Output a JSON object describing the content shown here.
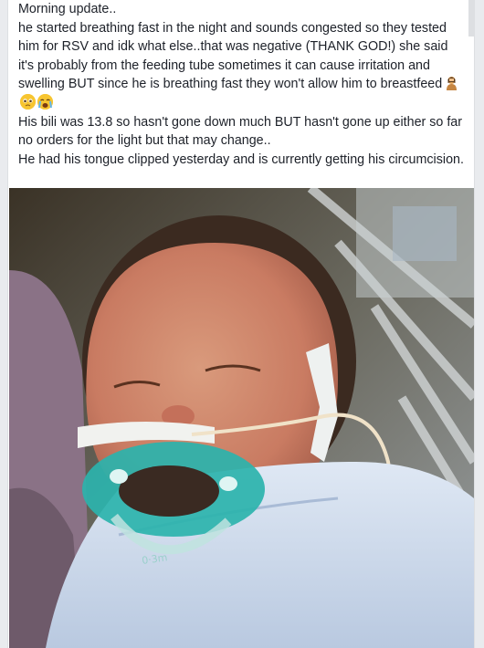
{
  "post": {
    "line1": "Morning update..",
    "line2": "he started breathing fast in the night and sounds congested so they tested him for RSV and idk what else..that was negative (THANK GOD!) she said it's probably from the feeding tube sometimes it can cause irritation and swelling BUT since he is breathing fast they won't allow him to breastfeed",
    "line3": "His bili was 13.8 so hasn't gone down much BUT hasn't gone up either so far no orders for the light but that may change..",
    "line4": "He had his tongue clipped yesterday and is currently getting his circumcision.",
    "emojis": [
      "woman-facepalming-icon",
      "pleading-face-icon",
      "crying-face-icon"
    ]
  },
  "colors": {
    "page_bg": "#e9ebee",
    "card_bg": "#ffffff",
    "text": "#1d2129",
    "pacifier": "#2bb3ad"
  }
}
